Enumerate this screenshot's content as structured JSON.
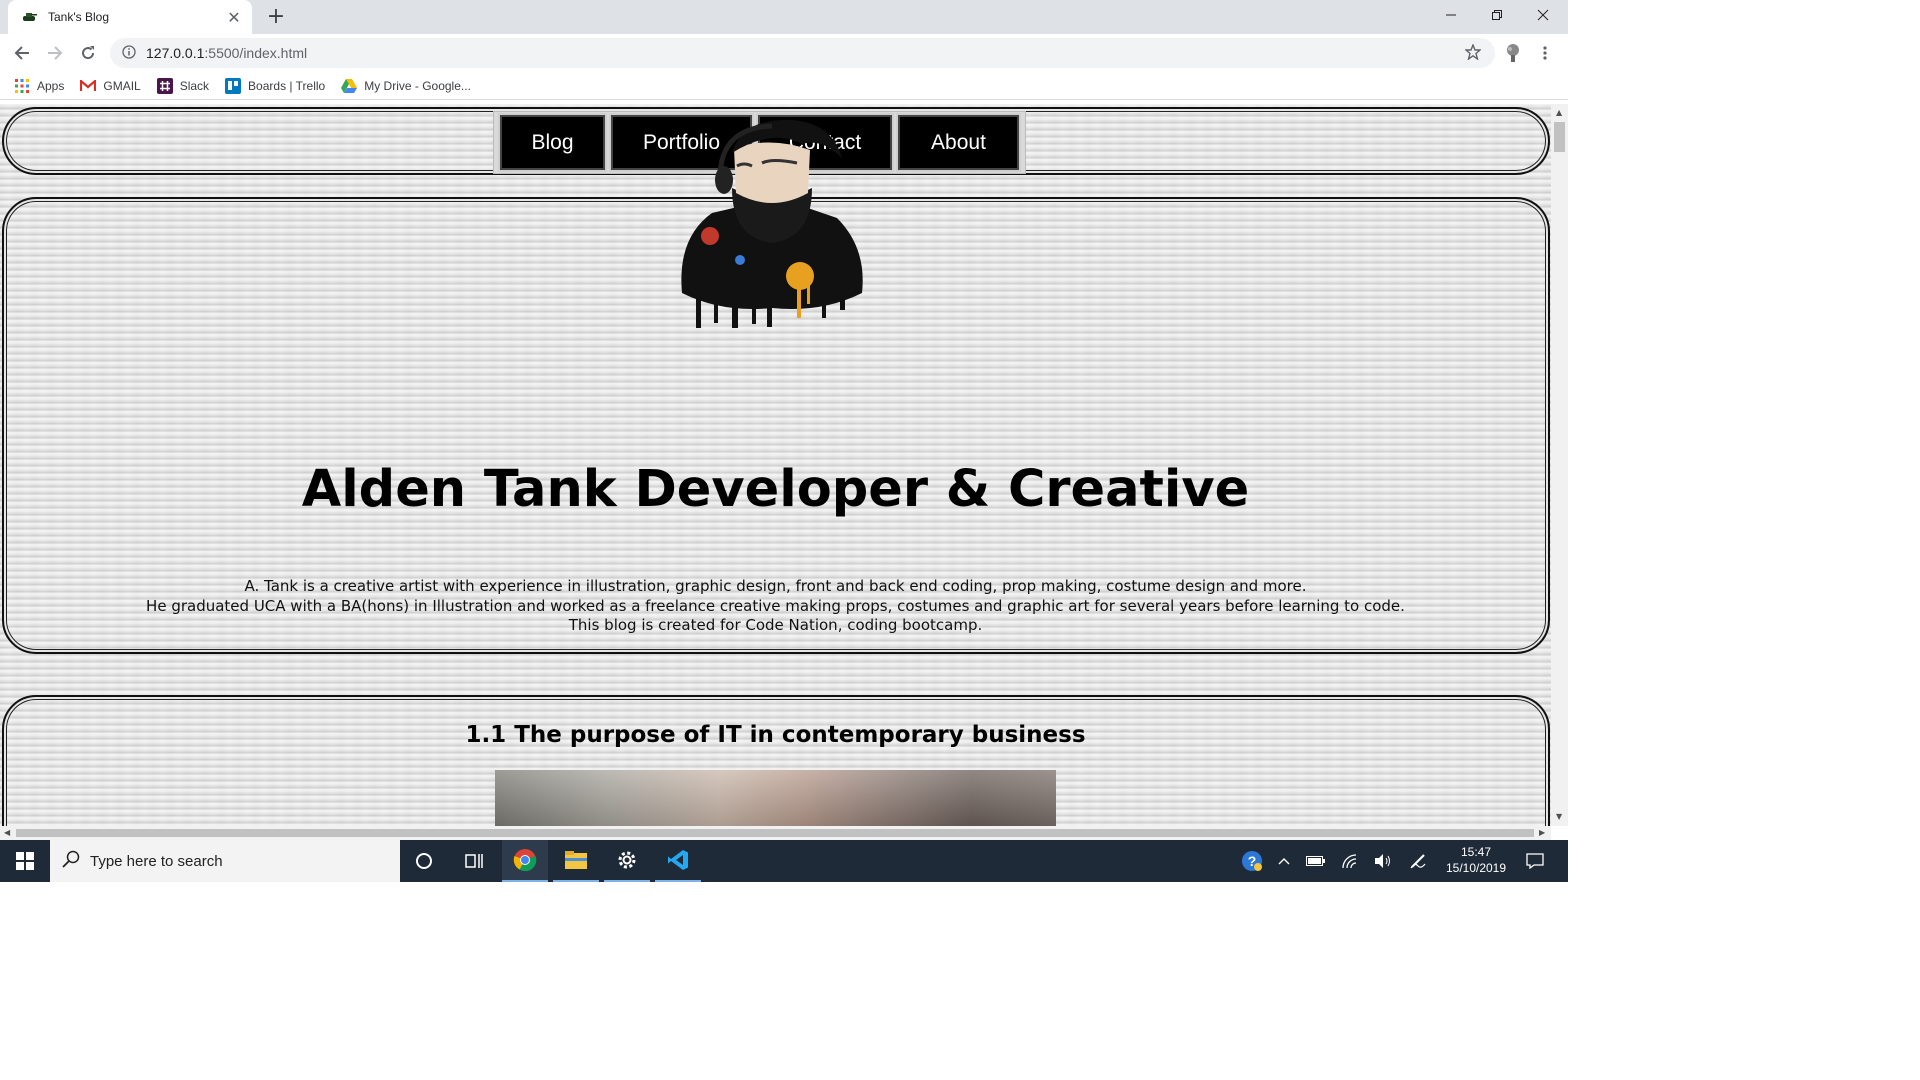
{
  "browser": {
    "tab_title": "Tank's Blog",
    "url_host": "127.0.0.1",
    "url_rest": ":5500/index.html",
    "bookmarks": [
      {
        "label": "Apps",
        "icon": "apps-grid-icon"
      },
      {
        "label": "GMAIL",
        "icon": "gmail-icon"
      },
      {
        "label": "Slack",
        "icon": "slack-icon"
      },
      {
        "label": "Boards | Trello",
        "icon": "trello-icon"
      },
      {
        "label": "My Drive - Google...",
        "icon": "google-drive-icon"
      }
    ]
  },
  "page": {
    "nav": [
      "Blog",
      "Portfolio",
      "Contact",
      "About"
    ],
    "hero_title": "Alden Tank Developer & Creative",
    "bio": [
      "A. Tank is a creative artist with experience in illustration, graphic design, front and back end coding, prop making, costume design and more.",
      "He graduated UCA with a BA(hons) in Illustration and worked as a freelance creative making props, costumes and graphic art for several years before learning to code.",
      "This blog is created for Code Nation, coding bootcamp."
    ],
    "post_title": "1.1 The purpose of IT in contemporary business"
  },
  "taskbar": {
    "search_placeholder": "Type here to search",
    "time": "15:47",
    "date": "15/10/2019"
  },
  "colors": {
    "nav_button_bg": "#000000",
    "taskbar_bg": "#1f2a38",
    "avatar_accent": "#e8a020"
  }
}
